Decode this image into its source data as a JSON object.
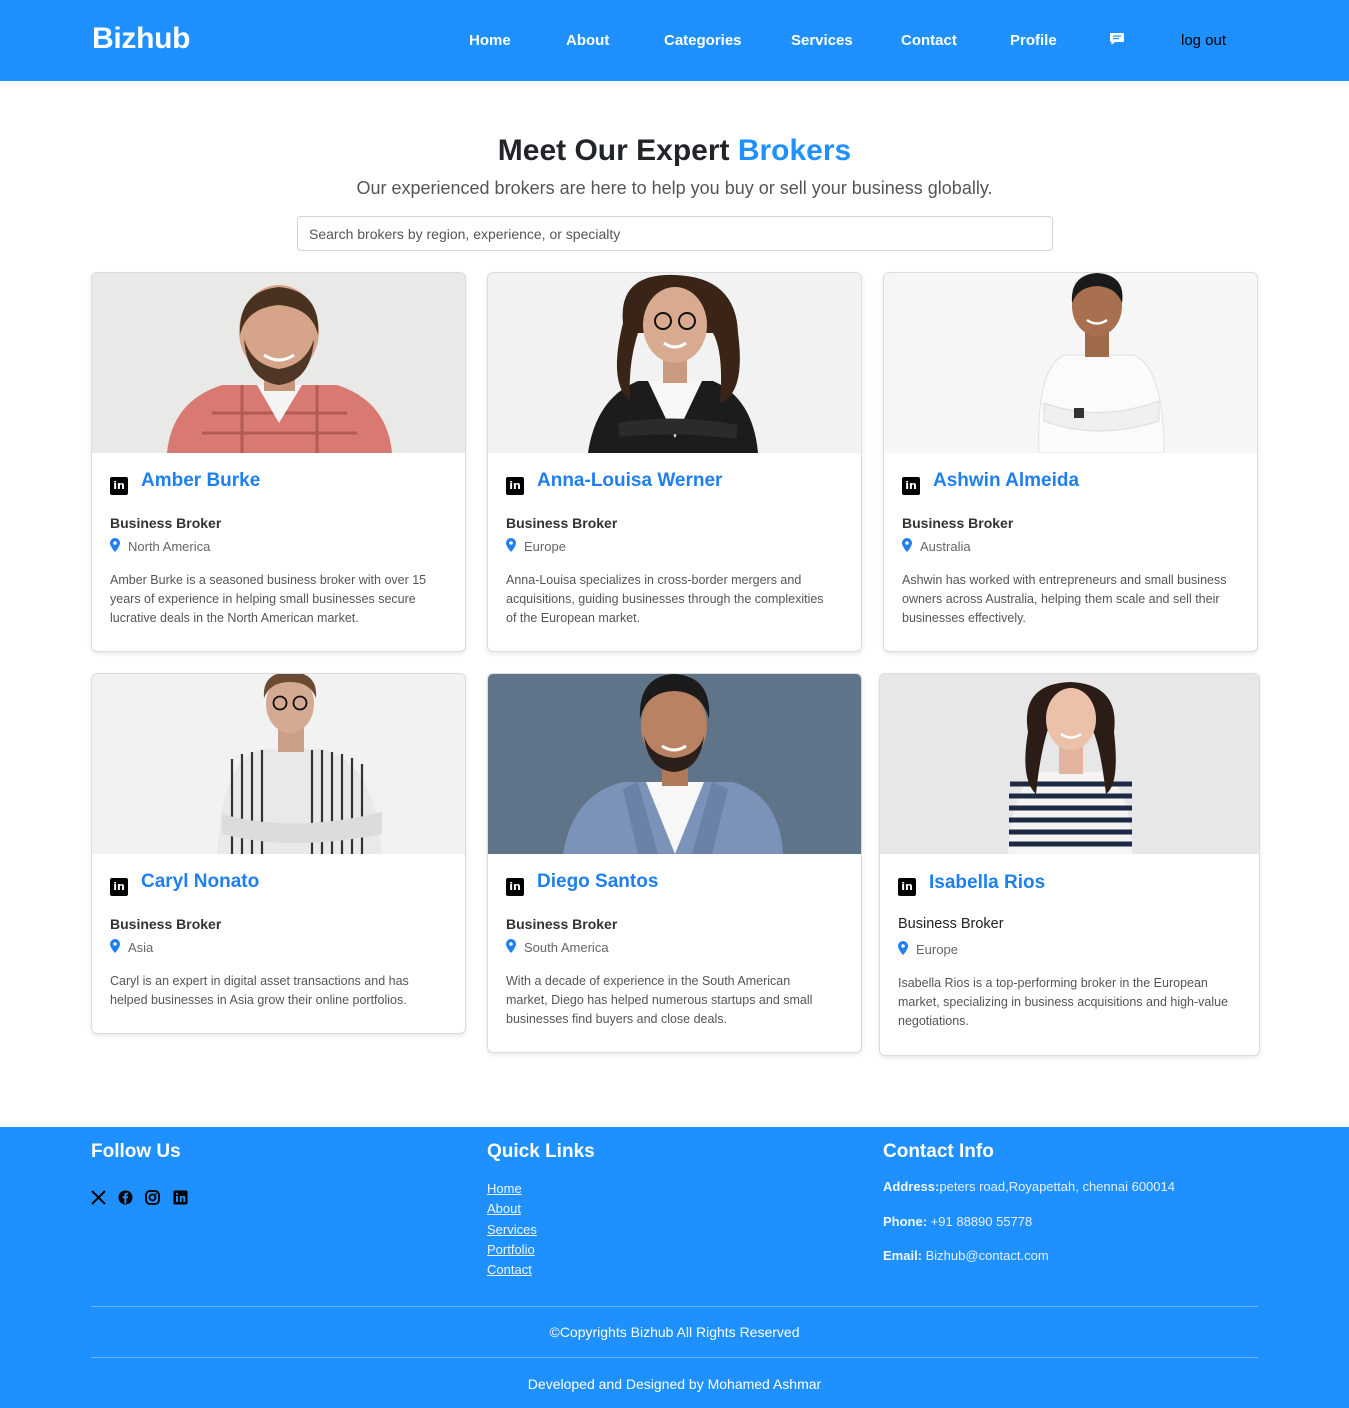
{
  "nav": {
    "brand": "Bizhub",
    "links": [
      "Home",
      "About",
      "Categories",
      "Services",
      "Contact",
      "Profile"
    ],
    "chat_icon": "message-icon",
    "logout": "log out"
  },
  "hero": {
    "title_main": "Meet Our Expert ",
    "title_accent": "Brokers",
    "subtitle": "Our experienced brokers are here to help you buy or sell your business globally.",
    "search_placeholder": "Search brokers by region, experience, or specialty"
  },
  "brokers": [
    {
      "name": "Amber Burke",
      "role": "Business Broker",
      "region": "North America",
      "description": "Amber Burke is a seasoned business broker with over 15 years of experience in helping small businesses secure lucrative deals in the North American market."
    },
    {
      "name": "Anna-Louisa Werner",
      "role": "Business Broker",
      "region": "Europe",
      "description": "Anna-Louisa specializes in cross-border mergers and acquisitions, guiding businesses through the complexities of the European market."
    },
    {
      "name": "Ashwin Almeida",
      "role": "Business Broker",
      "region": "Australia",
      "description": "Ashwin has worked with entrepreneurs and small business owners across Australia, helping them scale and sell their businesses effectively."
    },
    {
      "name": "Caryl Nonato",
      "role": "Business Broker",
      "region": "Asia",
      "description": "Caryl is an expert in digital asset transactions and has helped businesses in Asia grow their online portfolios."
    },
    {
      "name": "Diego Santos",
      "role": "Business Broker",
      "region": "South America",
      "description": "With a decade of experience in the South American market, Diego has helped numerous startups and small businesses find buyers and close deals."
    },
    {
      "name": "Isabella Rios",
      "role": "Business Broker",
      "region": "Europe",
      "description": "Isabella Rios is a top-performing broker in the European market, specializing in business acquisitions and high-value negotiations."
    }
  ],
  "footer": {
    "follow_title": "Follow Us",
    "social_icons": [
      "x-icon",
      "facebook-icon",
      "instagram-icon",
      "linkedin-icon"
    ],
    "quick_title": "Quick Links",
    "quick_links": [
      "Home",
      "About",
      "Services",
      "Portfolio",
      "Contact"
    ],
    "contact_title": "Contact Info",
    "address_label": "Address:",
    "address_value": "peters road,Royapettah, chennai 600014",
    "phone_label": "Phone:",
    "phone_value": " +91 88890 55778",
    "email_label": "Email:",
    "email_value": " Bizhub@contact.com",
    "copyright": "©Copyrights Bizhub All Rights Reserved",
    "developer": "Developed and Designed by Mohamed Ashmar"
  },
  "colors": {
    "brand_blue": "#1e90ff",
    "name_blue": "#1e7ff0"
  }
}
